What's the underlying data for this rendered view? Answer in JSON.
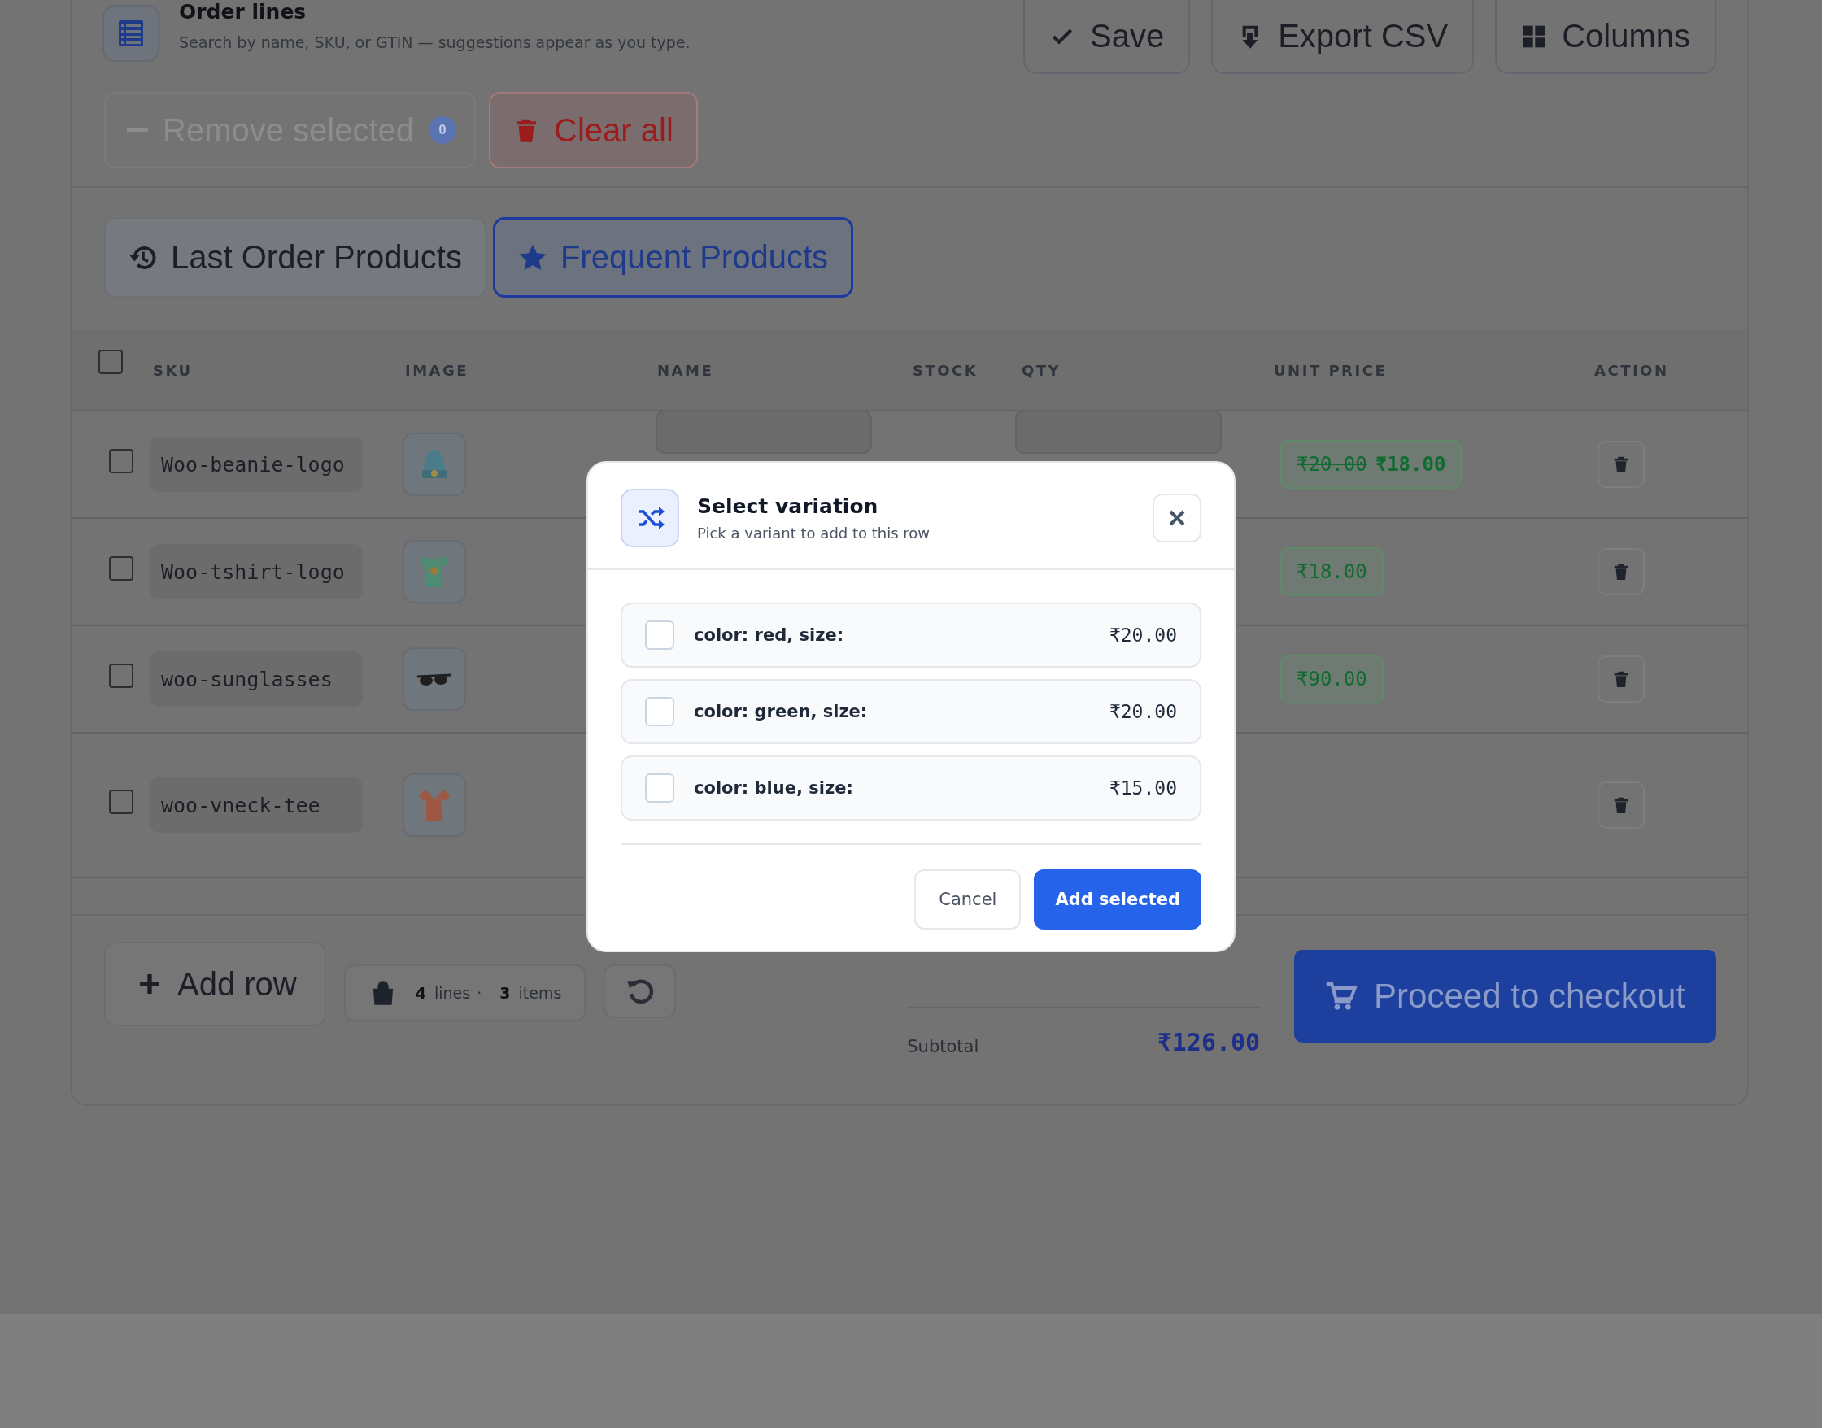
{
  "header": {
    "title": "Order lines",
    "subtitle": "Search by name, SKU, or GTIN — suggestions appear as you type."
  },
  "toolbar": [
    {
      "kind": "save",
      "label": "Save"
    },
    {
      "kind": "export",
      "label": "Export CSV"
    },
    {
      "kind": "columns",
      "label": "Columns"
    }
  ],
  "remove_selected": {
    "label": "Remove selected",
    "count": "0",
    "disabled": true
  },
  "clear_all": {
    "label": "Clear all"
  },
  "tabs": [
    {
      "kind": "history",
      "label": "Last Order Products",
      "selected": false
    },
    {
      "kind": "star",
      "label": "Frequent Products",
      "selected": true
    }
  ],
  "table": {
    "select_all": {
      "checked": false
    },
    "columns": [
      "SKU",
      "IMAGE",
      "NAME",
      "STOCK",
      "QTY",
      "UNIT PRICE",
      "ACTION"
    ],
    "rows": [
      {
        "checked": false,
        "sku": "Woo-beanie-logo",
        "kind": "beanie",
        "old_price": "₹20.00",
        "price": "₹18.00",
        "covered_fields": true
      },
      {
        "checked": false,
        "sku": "Woo-tshirt-logo",
        "kind": "tshirt",
        "price": "₹18.00"
      },
      {
        "checked": false,
        "sku": "woo-sunglasses",
        "kind": "sunglasses",
        "price": "₹90.00"
      },
      {
        "checked": false,
        "sku": "woo-vneck-tee",
        "kind": "vneck"
      }
    ]
  },
  "footer": {
    "add_row": "Add row",
    "lines_count": "4",
    "lines_label": "lines",
    "separator": "·",
    "items_count": "3",
    "items_label": "items",
    "subtotal_label": "Subtotal",
    "subtotal_value": "₹126.00",
    "checkout": "Proceed to checkout"
  },
  "modal": {
    "title": "Select variation",
    "subtitle": "Pick a variant to add to this row",
    "options": [
      {
        "label": "color: red, size:",
        "price": "₹20.00",
        "checked": false
      },
      {
        "label": "color: green, size:",
        "price": "₹20.00",
        "checked": false
      },
      {
        "label": "color: blue, size:",
        "price": "₹15.00",
        "checked": false
      }
    ],
    "cancel": "Cancel",
    "confirm": "Add selected"
  }
}
